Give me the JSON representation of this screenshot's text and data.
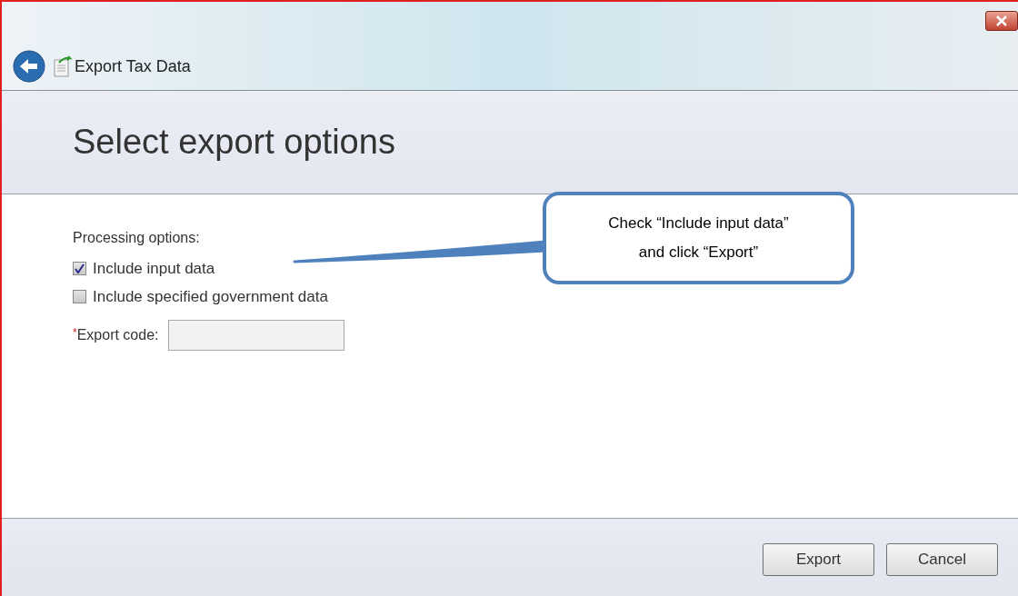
{
  "window": {
    "title": "Export Tax Data"
  },
  "header": {
    "title": "Select export options"
  },
  "processing": {
    "label": "Processing options:",
    "options": [
      {
        "label": "Include input data",
        "checked": true
      },
      {
        "label": "Include specified government data",
        "checked": false
      }
    ]
  },
  "export_code": {
    "required_mark": "*",
    "label": "Export code:"
  },
  "callout": {
    "lines": [
      "Check “Include input data”",
      "and click “Export”"
    ]
  },
  "buttons": [
    "Export",
    "Cancel"
  ]
}
